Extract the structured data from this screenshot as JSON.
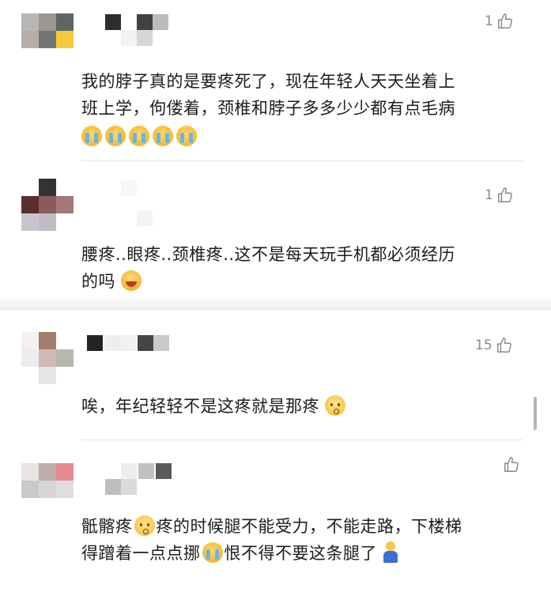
{
  "comments": [
    {
      "like_count": "1",
      "text_lines": [
        "我的脖子真的是要疼死了，现在年轻人天天坐着上",
        "班上学，佝偻着，颈椎和脖子多多少少都有点毛病"
      ],
      "emojis": [
        "crying-face-emoji",
        "crying-face-emoji",
        "crying-face-emoji",
        "crying-face-emoji",
        "crying-face-emoji"
      ],
      "avatar_colors": [
        "#b9b6b4",
        "#9c9591",
        "#5f6464",
        "#b5aea6",
        "#757575",
        "#f7c93b"
      ],
      "name_colors": [
        "#2d2d2d",
        "#f1f1f1",
        "#414141",
        "#bcbcbc",
        "#f2f2f2",
        "#d6d6d6"
      ]
    },
    {
      "like_count": "1",
      "text_line1": "腰疼..眼疼..颈椎疼..这不是每天玩手机都必须经历",
      "text_line2": "的吗",
      "emoji": "laughing-tears-emoji",
      "avatar_colors": [
        "#333333",
        "#8a5a5c",
        "#5a2e2f",
        "#a47878",
        "#bfa8ae",
        "#c9c5cd",
        "#bfbcc6"
      ],
      "name_colors": [
        "#f7f7f7",
        "#f4f4f4"
      ]
    },
    {
      "like_count": "15",
      "text": "唉，年纪轻轻不是这疼就是那疼",
      "emoji": "speechless-face-emoji",
      "avatar_colors": [
        "#f6f1ee",
        "#a57d6c",
        "#ededed",
        "#cfb9b6",
        "#eeeef2",
        "#e8e3e8",
        "#b6b8b0"
      ],
      "name_colors": [
        "#232323",
        "#eeeeee",
        "#f1f1f1",
        "#454545",
        "#cacaca"
      ]
    },
    {
      "like_count": "",
      "text_line1": "骶髂疼",
      "text_line1b": "疼的时候腿不能受力，不能走路，下楼梯",
      "text_line2": "得蹭着一点点挪",
      "text_line2b": "恨不得不要这条腿了",
      "emojis": [
        "speechless-face-emoji",
        "crying-face-emoji",
        "person-kneeling-emoji"
      ],
      "avatar_colors": [
        "#e9e4e3",
        "#bcadab",
        "#e48b94",
        "#c9c9c9",
        "#d5d5d5",
        "#dedede"
      ],
      "name_colors": [
        "#ededed",
        "#c1c1c1",
        "#5a5a5a",
        "#bebebe",
        "#dadada"
      ]
    }
  ],
  "colors": {
    "text": "#1c1c1c",
    "meta": "#8a8a8a",
    "divider": "#e6e6e6"
  }
}
